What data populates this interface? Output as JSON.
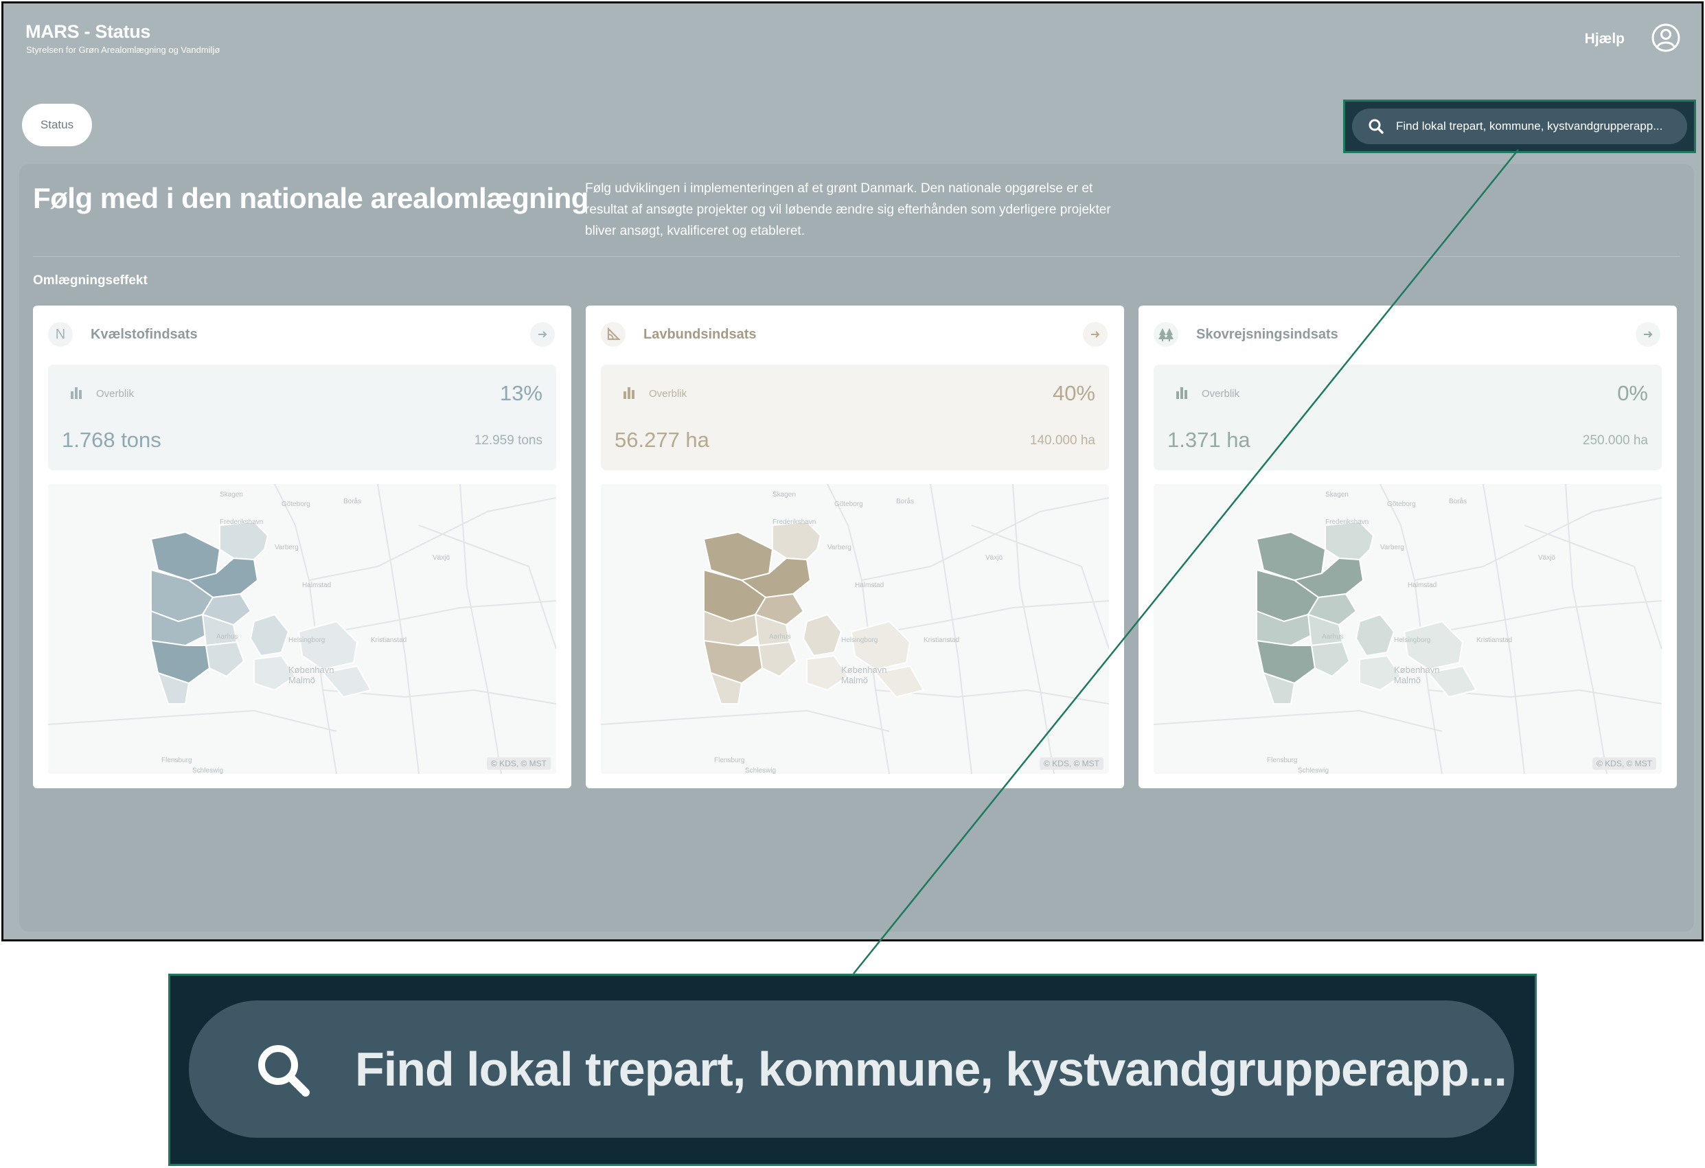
{
  "app": {
    "title": "MARS - Status",
    "subtitle": "Styrelsen for Grøn Arealomlægning og Vandmiljø",
    "help": "Hjælp"
  },
  "nav": {
    "status_tab": "Status"
  },
  "search": {
    "placeholder": "Find lokal trepart, kommune, kystvandgrupperapp..."
  },
  "hero": {
    "title": "Følg med i den nationale arealomlægning",
    "description": "Følg udviklingen i implementeringen af et grønt Danmark. Den nationale opgørelse er et resultat af ansøgte projekter og vil løbende ændre sig efterhånden som yderligere projekter bliver ansøgt, kvalificeret og etableret."
  },
  "section": {
    "label": "Omlægningseffekt"
  },
  "cards": [
    {
      "title": "Kvælstofindsats",
      "icon": "N",
      "stat_label": "Overblik",
      "percent": "13%",
      "value": "1.768 tons",
      "target": "12.959 tons",
      "attribution": "© KDS, © MST",
      "accent": "#8fa8b2",
      "box_bg": "#f1f5f6"
    },
    {
      "title": "Lavbundsindsats",
      "icon": "angle-icon",
      "stat_label": "Overblik",
      "percent": "40%",
      "value": "56.277 ha",
      "target": "140.000 ha",
      "attribution": "© KDS, © MST",
      "accent": "#b5a990",
      "box_bg": "#f5f3f0"
    },
    {
      "title": "Skovrejsningsindsats",
      "icon": "trees-icon",
      "stat_label": "Overblik",
      "percent": "0%",
      "value": "1.371 ha",
      "target": "250.000 ha",
      "attribution": "© KDS, © MST",
      "accent": "#94aaa2",
      "box_bg": "#f1f5f4"
    }
  ],
  "map_labels": [
    "Skagen",
    "Göteborg",
    "Borås",
    "Frederikshavn",
    "Varberg",
    "Växjö",
    "Halmstad",
    "Aarhus",
    "Helsingborg",
    "København",
    "Malmö",
    "Flensburg",
    "Schleswig",
    "Kristianstad"
  ],
  "colors": {
    "background": "#a9b5b9",
    "search_dark": "#1b3842",
    "callout_green": "#1d7a5f"
  }
}
